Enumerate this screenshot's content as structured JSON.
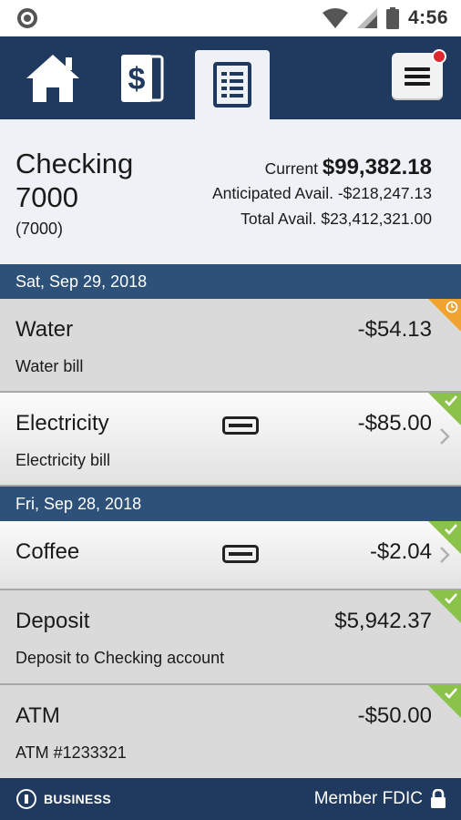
{
  "status_bar": {
    "time": "4:56"
  },
  "nav": {
    "tabs": [
      {
        "name": "home",
        "icon": "home-icon"
      },
      {
        "name": "accounts",
        "icon": "dollar-cards-icon"
      },
      {
        "name": "register",
        "icon": "register-list-icon",
        "active": true
      }
    ],
    "menu_icon": "hamburger-menu-icon",
    "notification": true
  },
  "account": {
    "name": "Checking 7000",
    "number": "(7000)",
    "current_label": "Current",
    "current_value": "$99,382.18",
    "anticipated_label": "Anticipated Avail.",
    "anticipated_value": "-$218,247.13",
    "total_label": "Total Avail.",
    "total_value": "$23,412,321.00"
  },
  "groups": [
    {
      "date": "Sat, Sep 29, 2018",
      "transactions": [
        {
          "title": "Water",
          "amount": "-$54.13",
          "description": "Water bill",
          "status": "pending"
        },
        {
          "title": "Electricity",
          "amount": "-$85.00",
          "description": "Electricity bill",
          "status": "cleared",
          "card": true,
          "chevron": true
        }
      ]
    },
    {
      "date": "Fri, Sep 28, 2018",
      "transactions": [
        {
          "title": "Coffee",
          "amount": "-$2.04",
          "status": "cleared",
          "card": true,
          "chevron": true
        },
        {
          "title": "Deposit",
          "amount": "$5,942.37",
          "description": "Deposit to Checking account",
          "status": "cleared"
        },
        {
          "title": "ATM",
          "amount": "-$50.00",
          "description": "ATM #1233321",
          "status": "cleared"
        }
      ]
    }
  ],
  "footer": {
    "business_label": "BUSINESS",
    "fdic_label": "Member FDIC"
  },
  "colors": {
    "nav_bg": "#1f3a5e",
    "date_header_bg": "#2d5178",
    "cleared": "#8bc34a",
    "pending": "#f0a32e",
    "notification": "#e0262f"
  }
}
